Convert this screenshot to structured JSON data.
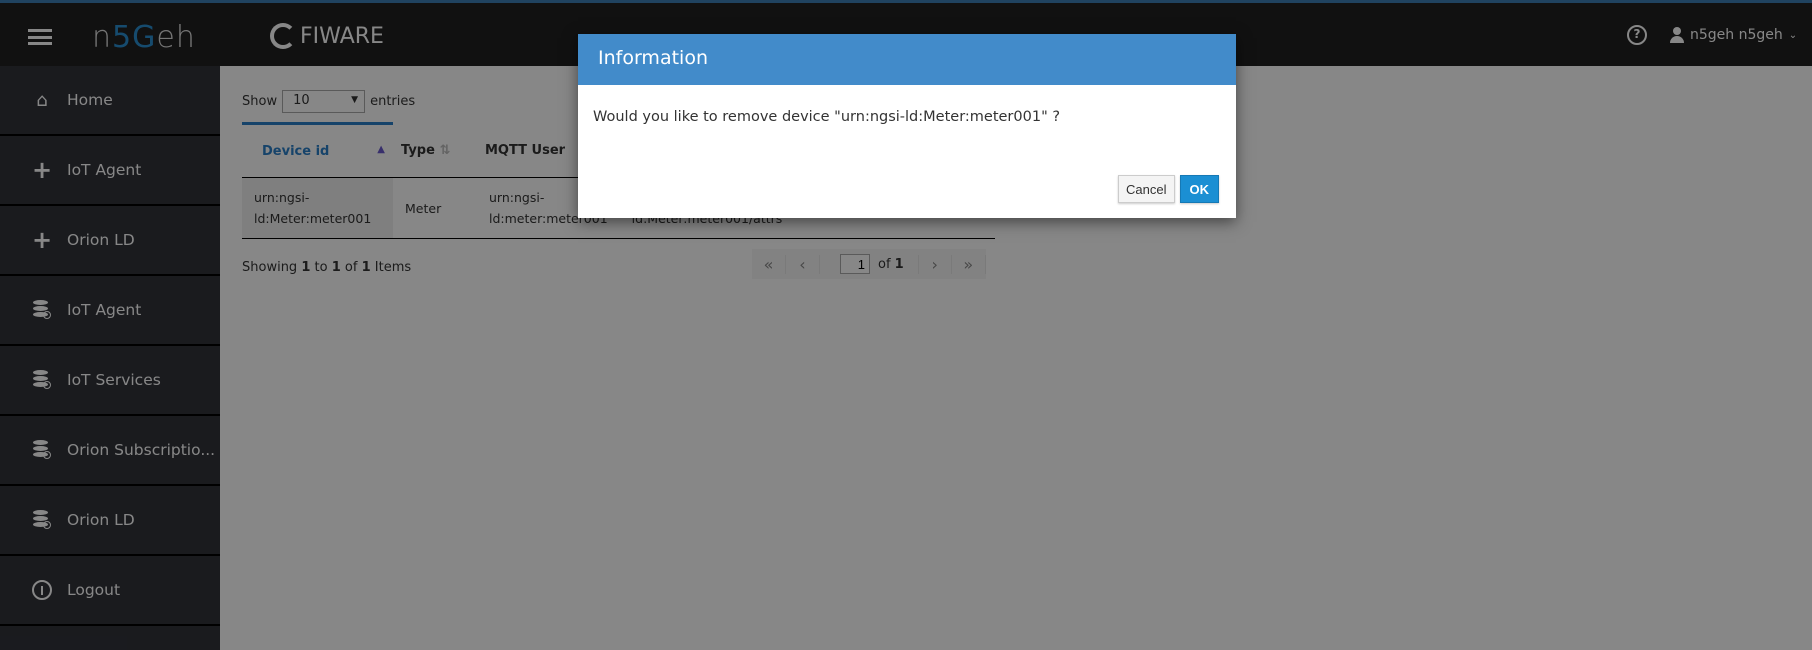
{
  "header": {
    "brand": "n5Geh",
    "brand_highlight": "5G",
    "fiware": "FIWARE",
    "user": "n5geh n5geh"
  },
  "sidebar": {
    "items": [
      {
        "label": "Home",
        "icon": "home-icon"
      },
      {
        "label": "IoT Agent",
        "icon": "plus-icon"
      },
      {
        "label": "Orion LD",
        "icon": "plus-icon"
      },
      {
        "label": "IoT Agent",
        "icon": "database-search-icon"
      },
      {
        "label": "IoT Services",
        "icon": "database-search-icon"
      },
      {
        "label": "Orion Subscriptio...",
        "icon": "database-search-icon"
      },
      {
        "label": "Orion LD",
        "icon": "database-search-icon"
      },
      {
        "label": "Logout",
        "icon": "power-icon"
      }
    ]
  },
  "table": {
    "show_label": "Show",
    "entries_label": "entries",
    "page_size": "10",
    "columns": [
      "Device id",
      "Type",
      "MQTT User"
    ],
    "rows": [
      {
        "device_id_1": "urn:ngsi-",
        "device_id_2": "ld:Meter:meter001",
        "type": "Meter",
        "mqtt_1": "urn:ngsi-",
        "mqtt_2": "ld:meter:meter001",
        "topic_2": "ld:Meter:meter001/attrs"
      }
    ],
    "showing": {
      "prefix": "Showing",
      "from": "1",
      "to_label": "to",
      "to": "1",
      "of_label": "of",
      "total": "1",
      "suffix": "Items"
    },
    "pager": {
      "page": "1",
      "of_label": "of",
      "pages": "1"
    }
  },
  "modal": {
    "title": "Information",
    "message": "Would you like to remove device \"urn:ngsi-ld:Meter:meter001\" ?",
    "cancel": "Cancel",
    "ok": "OK"
  },
  "colors": {
    "modal_header": "#428bca",
    "accent": "#2b7fc8",
    "ok_button": "#1b8fd3"
  }
}
